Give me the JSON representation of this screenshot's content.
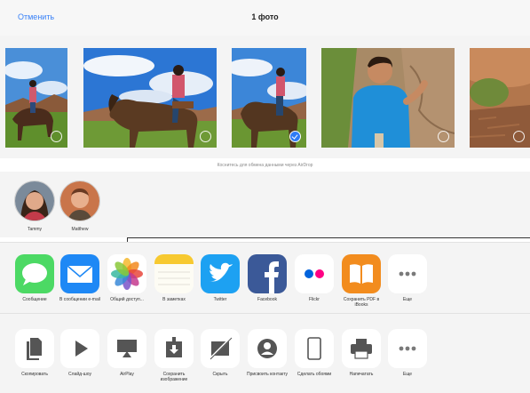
{
  "header": {
    "cancel_label": "Отменить",
    "title": "1 фото"
  },
  "photos": [
    {
      "name": "horse-rider-small",
      "selected": false
    },
    {
      "name": "horse-rider-large",
      "selected": false
    },
    {
      "name": "horse-rider-selected",
      "selected": true
    },
    {
      "name": "man-blue-shirt",
      "selected": false
    },
    {
      "name": "canyon-landscape",
      "selected": false
    }
  ],
  "airdrop": {
    "hint": "Коснитесь для обмена данными через AirDrop",
    "contacts": [
      {
        "name": "Tammy"
      },
      {
        "name": "Matthew"
      }
    ]
  },
  "share_apps": [
    {
      "label": "Сообщение",
      "icon": "messages-icon"
    },
    {
      "label": "В сообщении e-mail",
      "icon": "mail-icon"
    },
    {
      "label": "Общий доступ...",
      "icon": "photos-icon"
    },
    {
      "label": "В заметках",
      "icon": "notes-icon"
    },
    {
      "label": "Twitter",
      "icon": "twitter-icon"
    },
    {
      "label": "Facebook",
      "icon": "facebook-icon"
    },
    {
      "label": "Flickr",
      "icon": "flickr-icon"
    },
    {
      "label": "Сохранить PDF в iBooks",
      "icon": "ibooks-icon"
    },
    {
      "label": "Еще",
      "icon": "more-icon"
    }
  ],
  "actions": [
    {
      "label": "Скопировать",
      "icon": "copy-icon"
    },
    {
      "label": "Слайд-шоу",
      "icon": "play-icon"
    },
    {
      "label": "AirPlay",
      "icon": "airplay-icon"
    },
    {
      "label": "Сохранить изображение",
      "icon": "save-image-icon"
    },
    {
      "label": "Скрыть",
      "icon": "hide-icon"
    },
    {
      "label": "Присвоить контакту",
      "icon": "assign-contact-icon"
    },
    {
      "label": "Сделать обоями",
      "icon": "wallpaper-icon"
    },
    {
      "label": "Напечатать",
      "icon": "print-icon"
    },
    {
      "label": "Еще",
      "icon": "more-icon"
    }
  ],
  "colors": {
    "accent": "#3a82f7",
    "selection": "#2f7bf5",
    "messages": "#4cd964",
    "mail": "#1e88f5",
    "twitter": "#1da1f2",
    "facebook": "#3b5998",
    "ibooks": "#f28c1e"
  }
}
